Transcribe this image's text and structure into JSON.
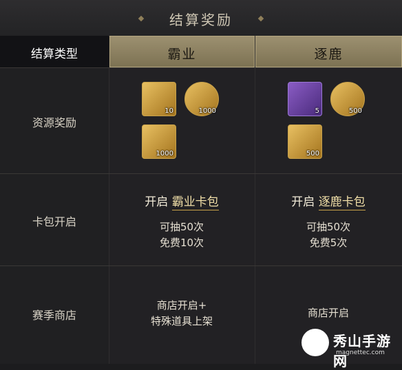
{
  "title": "结算奖励",
  "header": {
    "type_label": "结算类型",
    "col1": "霸业",
    "col2": "逐鹿"
  },
  "rows": {
    "resources": {
      "label": "资源奖励",
      "col1": [
        {
          "icon": "bronze-token-icon",
          "qty": "10"
        },
        {
          "icon": "mooncake-icon",
          "qty": "1000"
        },
        {
          "icon": "gold-coin-icon",
          "qty": "1000"
        }
      ],
      "col2": [
        {
          "icon": "purple-token-icon",
          "qty": "5"
        },
        {
          "icon": "mooncake-icon",
          "qty": "500"
        },
        {
          "icon": "gold-coin-icon",
          "qty": "500"
        }
      ]
    },
    "card_pack": {
      "label": "卡包开启",
      "col1": {
        "open": "开启",
        "pack": "霸业卡包",
        "draws": "可抽50次",
        "free": "免费10次"
      },
      "col2": {
        "open": "开启",
        "pack": "逐鹿卡包",
        "draws": "可抽50次",
        "free": "免费5次"
      }
    },
    "shop": {
      "label": "赛季商店",
      "col1_line1": "商店开启+",
      "col1_line2": "特殊道具上架",
      "col2": "商店开启"
    }
  },
  "watermark": {
    "text": "秀山手游网",
    "sub": "magnettec.com"
  },
  "colors": {
    "gold_header": "#9c9070",
    "accent_gold": "#c9a24a",
    "background": "#1c1c1e"
  }
}
